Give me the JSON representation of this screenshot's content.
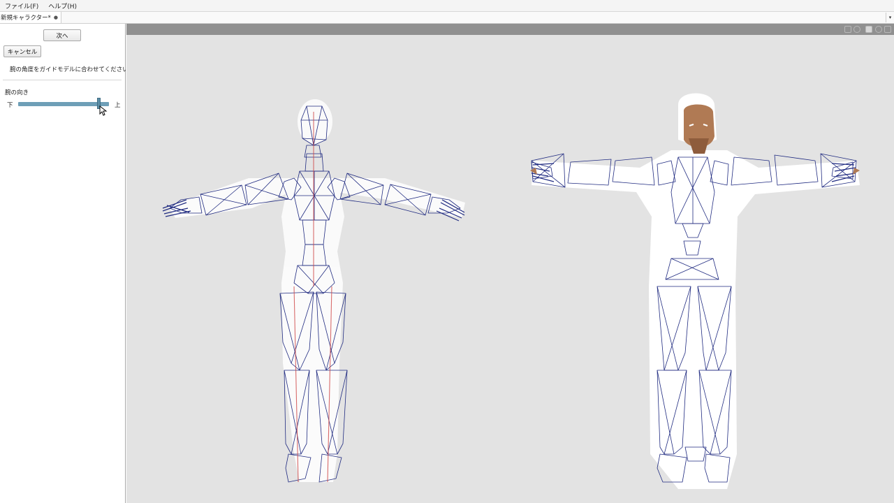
{
  "menubar": {
    "file": "ファイル(F)",
    "help": "ヘルプ(H)"
  },
  "tabs": [
    {
      "label": "新規キャラクター*",
      "close": "●"
    }
  ],
  "tab_dropdown": "▾",
  "sidebar": {
    "next_label": "次へ",
    "cancel_label": "キャンセル",
    "instruction": "腕の角度をガイドモデルに合わせてください。",
    "arm_direction_label": "腕の向き",
    "slider": {
      "min_label": "下",
      "max_label": "上",
      "value": 0.9
    }
  },
  "viewport": {
    "toolbar_icons": [
      "grid-icon",
      "sphere-icon",
      "camera-icon",
      "gear-icon",
      "close-icon"
    ],
    "colors": {
      "background": "#e3e3e3",
      "wireframe": "#1f2a80",
      "bone": "#d04848",
      "skin": "#b07a54",
      "silhouette": "#ffffff"
    }
  }
}
